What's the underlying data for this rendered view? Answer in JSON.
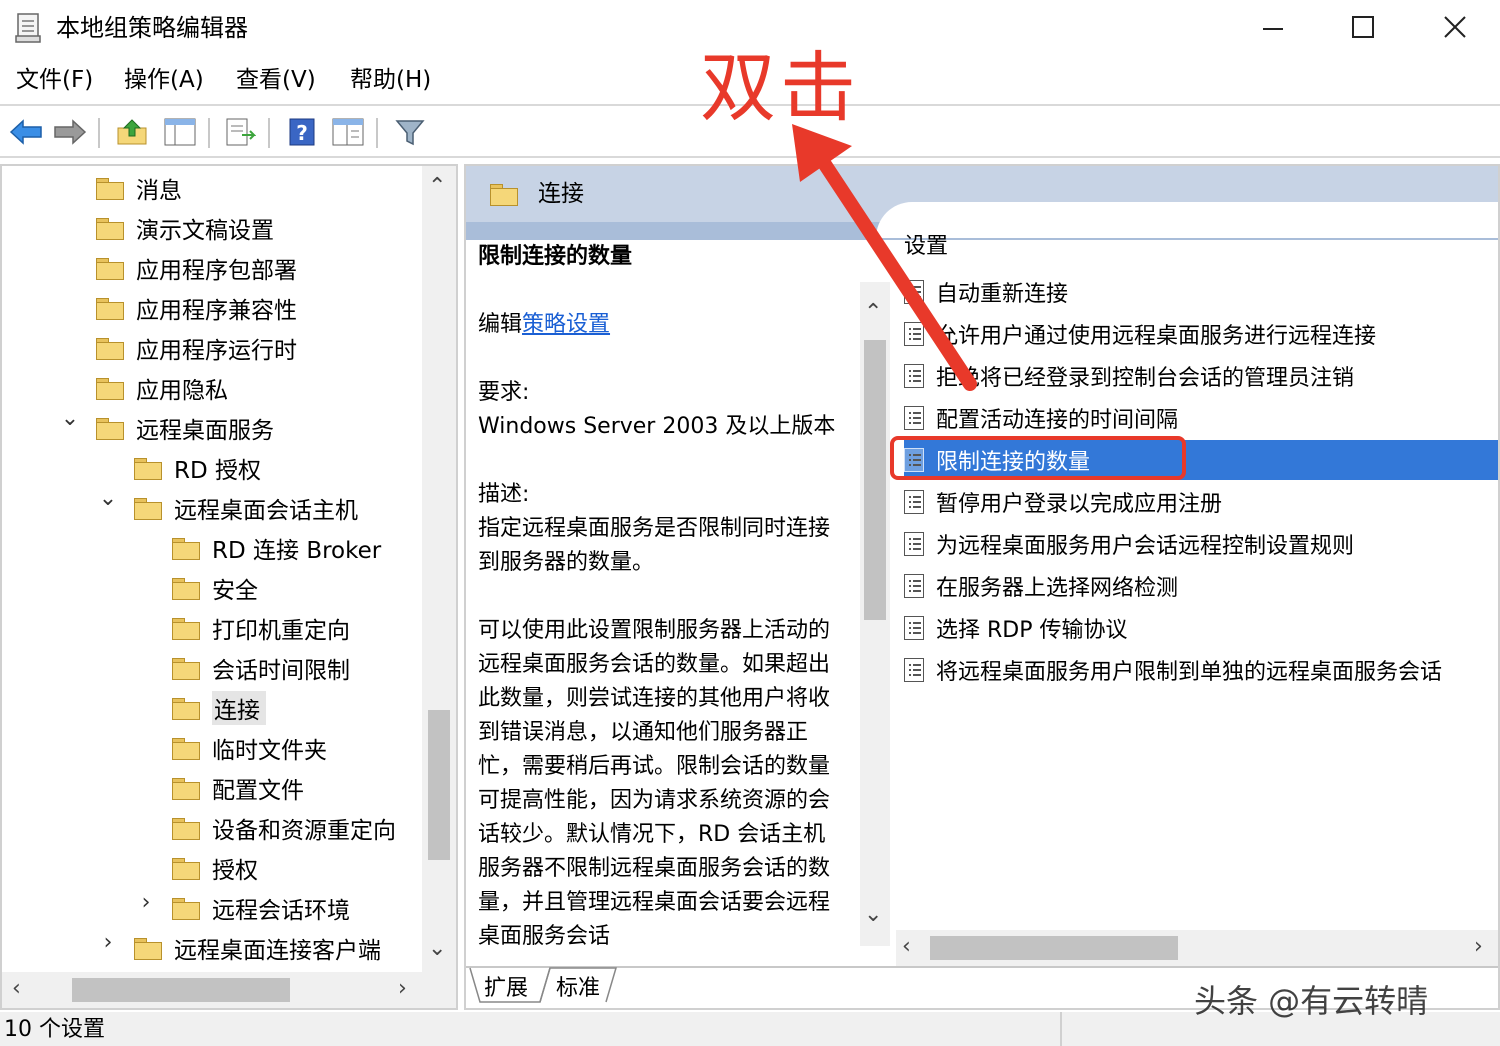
{
  "window": {
    "title": "本地组策略编辑器",
    "min_glyph": "—",
    "max_glyph": "☐",
    "close_glyph": "✕"
  },
  "menu": [
    "文件(F)",
    "操作(A)",
    "查看(V)",
    "帮助(H)"
  ],
  "toolbar_icons": [
    "back-icon",
    "forward-icon",
    "up-folder-icon",
    "show-hide-tree-icon",
    "export-list-icon",
    "help-icon",
    "extended-view-icon",
    "filter-icon"
  ],
  "tree": {
    "items": [
      {
        "label": "消息",
        "indent": 0,
        "chevron": ""
      },
      {
        "label": "演示文稿设置",
        "indent": 0,
        "chevron": ""
      },
      {
        "label": "应用程序包部署",
        "indent": 0,
        "chevron": ""
      },
      {
        "label": "应用程序兼容性",
        "indent": 0,
        "chevron": ""
      },
      {
        "label": "应用程序运行时",
        "indent": 0,
        "chevron": ""
      },
      {
        "label": "应用隐私",
        "indent": 0,
        "chevron": ""
      },
      {
        "label": "远程桌面服务",
        "indent": 0,
        "chevron": "⌄"
      },
      {
        "label": "RD 授权",
        "indent": 1,
        "chevron": ""
      },
      {
        "label": "远程桌面会话主机",
        "indent": 1,
        "chevron": "⌄"
      },
      {
        "label": "RD 连接 Broker",
        "indent": 2,
        "chevron": ""
      },
      {
        "label": "安全",
        "indent": 2,
        "chevron": ""
      },
      {
        "label": "打印机重定向",
        "indent": 2,
        "chevron": ""
      },
      {
        "label": "会话时间限制",
        "indent": 2,
        "chevron": ""
      },
      {
        "label": "连接",
        "indent": 2,
        "chevron": "",
        "selected": true
      },
      {
        "label": "临时文件夹",
        "indent": 2,
        "chevron": ""
      },
      {
        "label": "配置文件",
        "indent": 2,
        "chevron": ""
      },
      {
        "label": "设备和资源重定向",
        "indent": 2,
        "chevron": ""
      },
      {
        "label": "授权",
        "indent": 2,
        "chevron": ""
      },
      {
        "label": "远程会话环境",
        "indent": 2,
        "chevron": "›"
      },
      {
        "label": "远程桌面连接客户端",
        "indent": 1,
        "chevron": "›"
      }
    ]
  },
  "right": {
    "header_title": "连接",
    "description": {
      "title": "限制连接的数量",
      "edit_prefix": "编辑",
      "edit_link": "策略设置",
      "requirements_label": "要求:",
      "requirements": "Windows Server 2003 及以上版本",
      "description_label": "描述:",
      "description_p1": "指定远程桌面服务是否限制同时连接到服务器的数量。",
      "description_p2": "可以使用此设置限制服务器上活动的远程桌面服务会话的数量。如果超出此数量，则尝试连接的其他用户将收到错误消息，以通知他们服务器正忙，需要稍后再试。限制会话的数量可提高性能，因为请求系统资源的会话较少。默认情况下，RD 会话主机服务器不限制远程桌面服务会话的数量，并且管理远程桌面会话要会远程桌面服务会话"
    },
    "list_header": "设置",
    "settings": [
      "自动重新连接",
      "允许用户通过使用远程桌面服务进行远程连接",
      "拒绝将已经登录到控制台会话的管理员注销",
      "配置活动连接的时间间隔",
      "限制连接的数量",
      "暂停用户登录以完成应用注册",
      "为远程桌面服务用户会话远程控制设置规则",
      "在服务器上选择网络检测",
      "选择 RDP 传输协议",
      "将远程桌面服务用户限制到单独的远程桌面服务会话"
    ],
    "selected_index": 4,
    "tabs": [
      "扩展",
      "标准"
    ]
  },
  "status": {
    "text": "10 个设置"
  },
  "annotation": {
    "text": "双击",
    "color": "#e8392a"
  },
  "watermark": "头条 @有云转晴"
}
